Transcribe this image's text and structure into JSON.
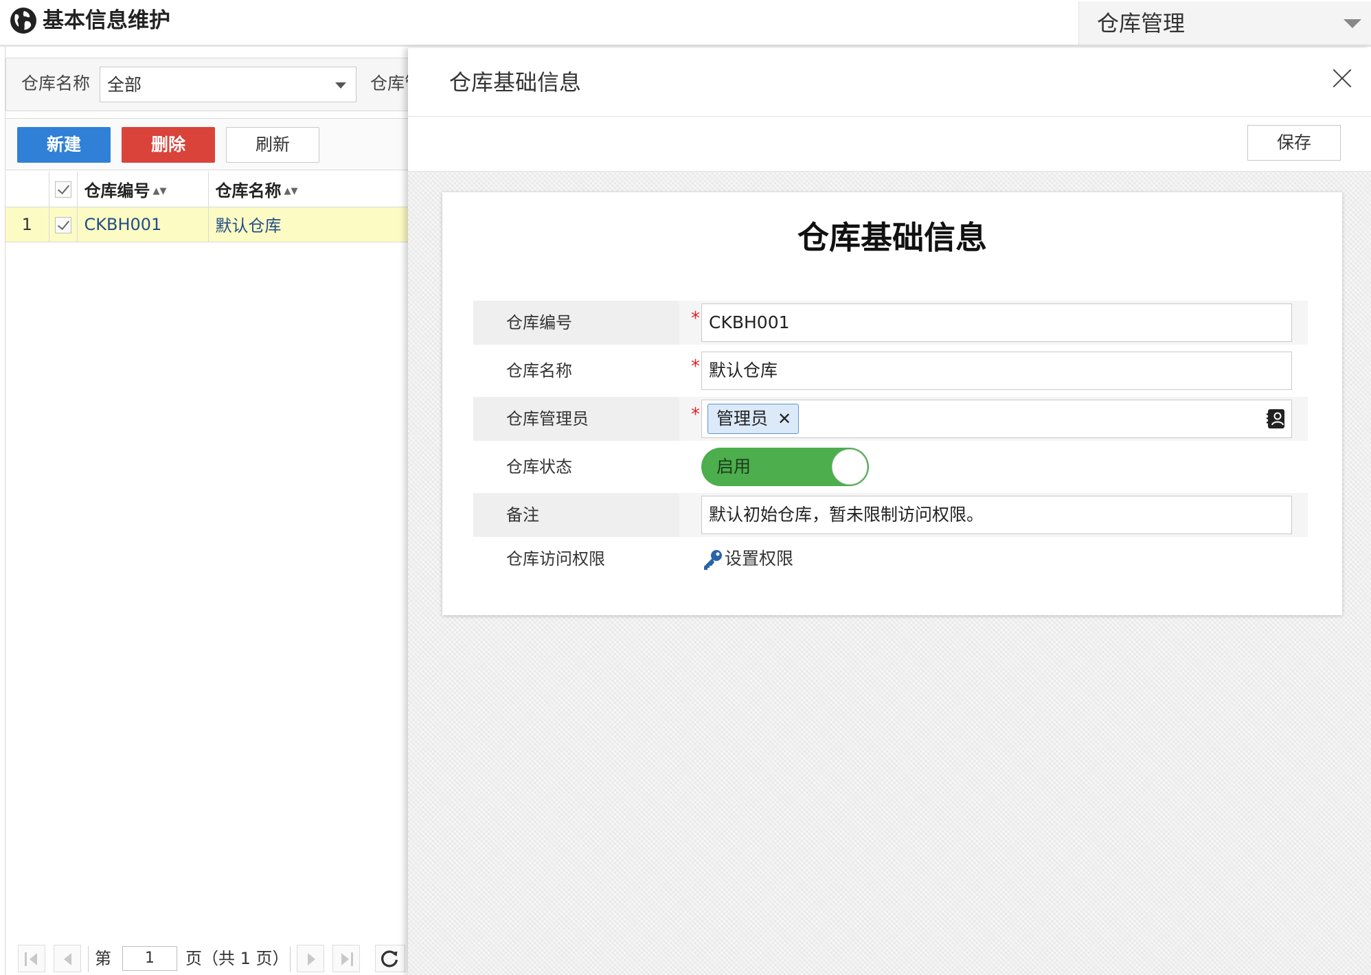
{
  "header": {
    "app_title": "基本信息维护",
    "module_selector": "仓库管理"
  },
  "filter": {
    "label": "仓库名称",
    "value": "全部",
    "label2": "仓库管"
  },
  "toolbar": {
    "new_label": "新建",
    "delete_label": "删除",
    "refresh_label": "刷新"
  },
  "grid": {
    "columns": [
      "仓库编号",
      "仓库名称"
    ],
    "rows": [
      {
        "num": "1",
        "code": "CKBH001",
        "name": "默认仓库"
      }
    ]
  },
  "pager": {
    "prefix": "第",
    "page": "1",
    "suffix": "页（共 1 页）"
  },
  "drawer": {
    "title": "仓库基础信息",
    "save_label": "保存",
    "form_title": "仓库基础信息",
    "fields": {
      "code": {
        "label": "仓库编号",
        "value": "CKBH001"
      },
      "name": {
        "label": "仓库名称",
        "value": "默认仓库"
      },
      "manager": {
        "label": "仓库管理员",
        "tag": "管理员",
        "tag_remove": "✕"
      },
      "status": {
        "label": "仓库状态",
        "value": "启用"
      },
      "remark": {
        "label": "备注",
        "value": "默认初始仓库，暂未限制访问权限。"
      },
      "access": {
        "label": "仓库访问权限",
        "link": "设置权限"
      }
    },
    "required_mark": "*"
  },
  "colors": {
    "primary": "#2f80d6",
    "danger": "#d9433a",
    "toggle_on": "#4cae4c",
    "selected_row": "#fdfbc4"
  },
  "icons": [
    "globe-icon",
    "chevron-down-icon",
    "close-icon",
    "contact-card-icon",
    "key-icon",
    "first-page-icon",
    "prev-page-icon",
    "next-page-icon",
    "last-page-icon",
    "refresh-icon"
  ]
}
